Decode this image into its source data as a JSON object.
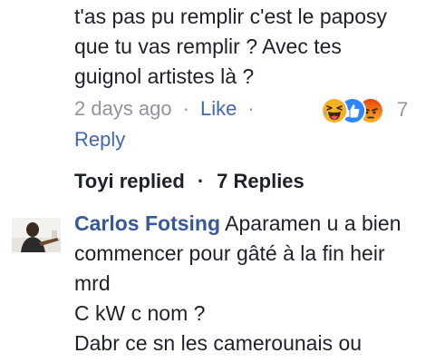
{
  "comment": {
    "lines": [
      "t'as pas pu remplir c'est le paposy",
      "que tu vas remplir ? Avec tes",
      "guignol artistes là ?"
    ],
    "timestamp": "2 days ago",
    "separator": "·",
    "like_label": "Like",
    "reply_label": "Reply",
    "reactions": {
      "icons": [
        "haha-reaction-icon",
        "like-reaction-icon",
        "angry-reaction-icon"
      ],
      "count": "7"
    }
  },
  "replies_summary": {
    "replier": "Toyi replied",
    "separator": "·",
    "count_label": "7 Replies"
  },
  "reply": {
    "author": "Carlos Fotsing",
    "first_line": "Aparamen u a bien",
    "lines": [
      "commencer pour gâté à la fin heir",
      "mrd",
      "C kW c nom ?",
      "Dabr ce sn les camerounais ou"
    ]
  },
  "colors": {
    "link": "#4267b2",
    "author": "#385898",
    "meta": "#90949c",
    "text": "#1d2129",
    "haha": "#f7b125",
    "like": "#2d88ff",
    "angry": "#e9710f"
  }
}
